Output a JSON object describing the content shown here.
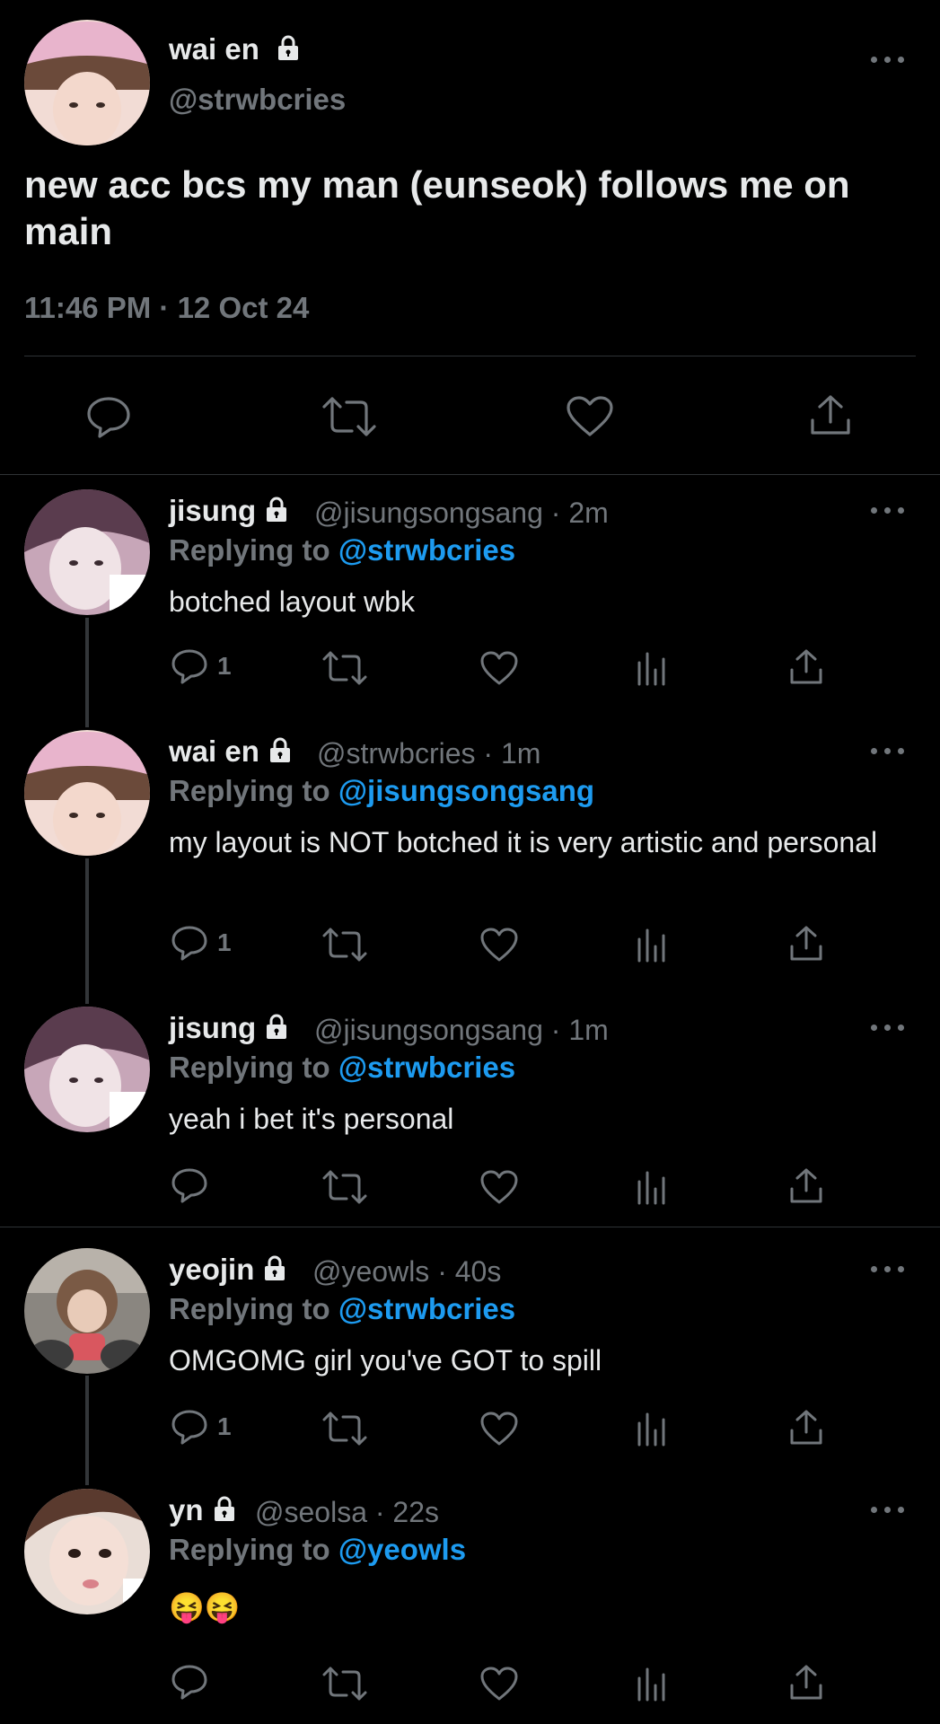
{
  "main_tweet": {
    "name": "wai en",
    "handle": "@strwbcries",
    "text": "new acc bcs my man (eunseok) follows me on main",
    "timestamp": "11:46 PM · 12 Oct 24"
  },
  "replies": [
    {
      "name": "jisung",
      "meta": "@jisungsongsang · 2m",
      "replying_label": "Replying to",
      "replying_to": "@strwbcries",
      "text": "botched layout wbk",
      "reply_count": "1"
    },
    {
      "name": "wai en",
      "meta": "@strwbcries · 1m",
      "replying_label": "Replying to",
      "replying_to": "@jisungsongsang",
      "text": "my layout is NOT botched it is very artistic and personal",
      "reply_count": "1"
    },
    {
      "name": "jisung",
      "meta": "@jisungsongsang · 1m",
      "replying_label": "Replying to",
      "replying_to": "@strwbcries",
      "text": "yeah i bet it's personal",
      "reply_count": ""
    },
    {
      "name": "yeojin",
      "meta": "@yeowls · 40s",
      "replying_label": "Replying to",
      "replying_to": "@strwbcries",
      "text": "OMGOMG girl you've GOT to spill",
      "reply_count": "1"
    },
    {
      "name": "yn",
      "meta": "@seolsa · 22s",
      "replying_label": "Replying to",
      "replying_to": "@yeowls",
      "text": "😝😝",
      "reply_count": ""
    }
  ],
  "icons": {
    "reply": "reply-icon",
    "retweet": "retweet-icon",
    "like": "heart-icon",
    "views": "views-icon",
    "share": "share-icon",
    "lock": "lock-icon",
    "more": "more-icon"
  },
  "colors": {
    "background": "#000000",
    "text": "#e7e9ea",
    "secondary": "#71767b",
    "mention": "#1d9bf0",
    "divider": "#2f3336"
  }
}
